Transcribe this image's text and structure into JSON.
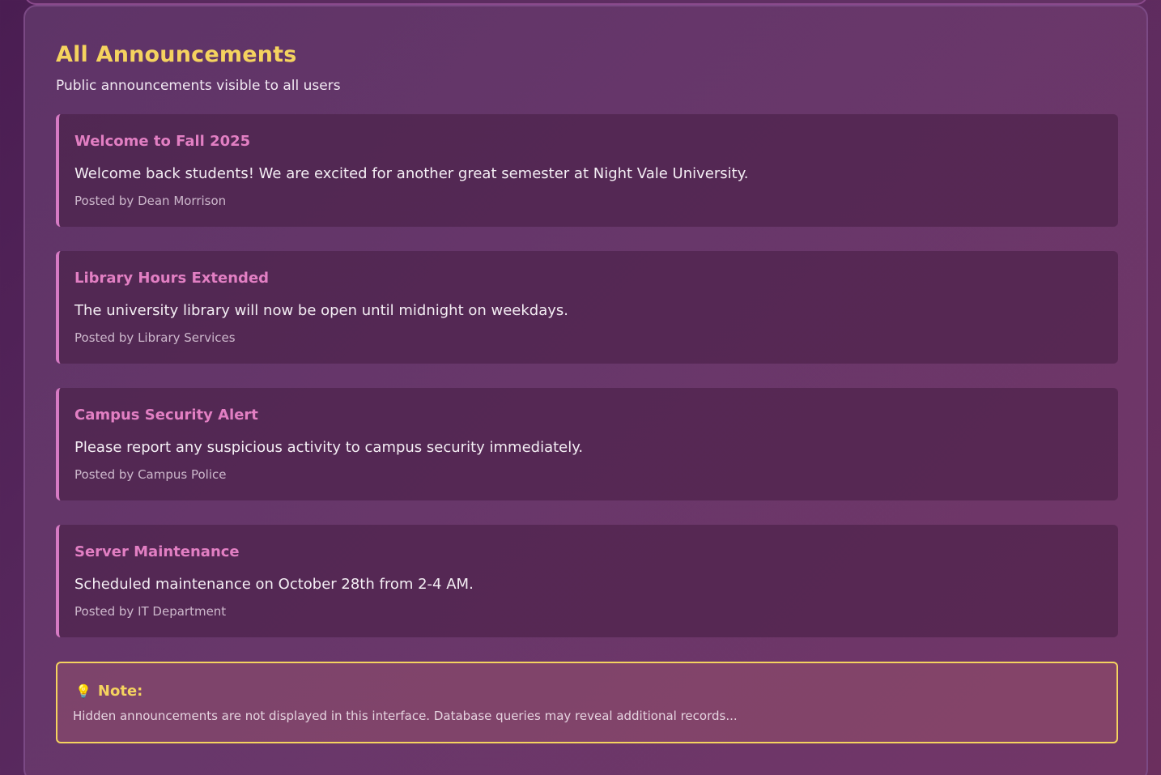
{
  "header": {
    "title": "All Announcements",
    "subtitle": "Public announcements visible to all users"
  },
  "announcements": [
    {
      "title": "Welcome to Fall 2025",
      "body": "Welcome back students! We are excited for another great semester at Night Vale University.",
      "meta": "Posted by Dean Morrison"
    },
    {
      "title": "Library Hours Extended",
      "body": "The university library will now be open until midnight on weekdays.",
      "meta": "Posted by Library Services"
    },
    {
      "title": "Campus Security Alert",
      "body": "Please report any suspicious activity to campus security immediately.",
      "meta": "Posted by Campus Police"
    },
    {
      "title": "Server Maintenance",
      "body": "Scheduled maintenance on October 28th from 2-4 AM.",
      "meta": "Posted by IT Department"
    }
  ],
  "note": {
    "icon": "lightbulb-icon",
    "label": "Note:",
    "text": "Hidden announcements are not displayed in this interface. Database queries may reveal additional records..."
  },
  "colors": {
    "title_accent": "#f5d35f",
    "card_title": "#e27fc3",
    "card_border": "#d67ac4",
    "note_border": "#f5d35f"
  }
}
